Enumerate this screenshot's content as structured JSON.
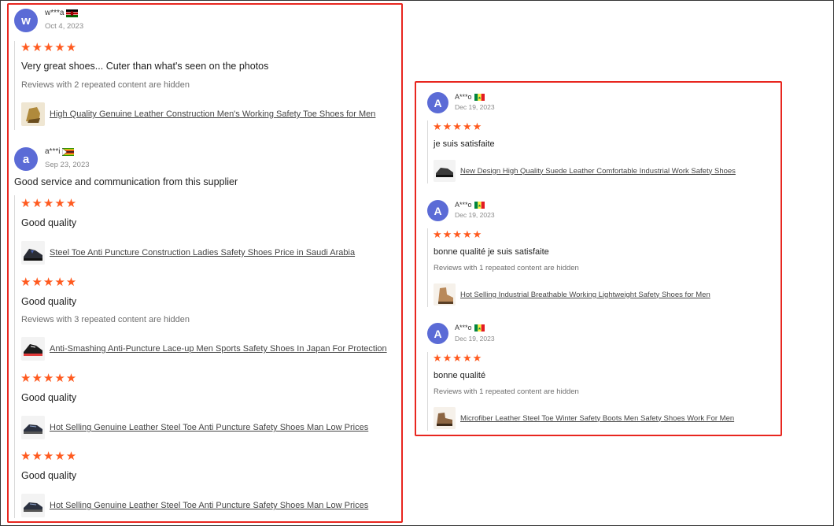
{
  "colors": {
    "highlight_border": "#e8261f",
    "star": "#ff5a1f",
    "avatar": "#5b6bd6"
  },
  "left_panel": {
    "reviewers": [
      {
        "avatar": "w",
        "name": "w***a",
        "flag": "kenya-flag",
        "date": "Oct 4, 2023",
        "reviews": [
          {
            "stars": "★★★★★",
            "text": "Very great shoes... Cuter than what's seen on the photos",
            "hidden_note": "Reviews with 2 repeated content are hidden",
            "product": "High Quality Genuine Leather Construction Men's Working Safety Toe Shoes for Men"
          }
        ]
      },
      {
        "avatar": "a",
        "name": "a***i",
        "flag": "zimbabwe-flag",
        "date": "Sep 23, 2023",
        "comment": "Good service and communication from this supplier",
        "reviews": [
          {
            "stars": "★★★★★",
            "text": "Good quality",
            "product": "Steel Toe Anti Puncture Construction Ladies Safety Shoes Price in Saudi Arabia"
          },
          {
            "stars": "★★★★★",
            "text": "Good quality",
            "hidden_note": "Reviews with 3 repeated content are hidden",
            "product": "Anti-Smashing Anti-Puncture Lace-up Men Sports Safety Shoes In Japan For Protection"
          },
          {
            "stars": "★★★★★",
            "text": "Good quality",
            "product": "Hot Selling Genuine Leather Steel Toe Anti Puncture Safety Shoes Man Low Prices"
          },
          {
            "stars": "★★★★★",
            "text": "Good quality",
            "product": "Hot Selling Genuine Leather Steel Toe Anti Puncture Safety Shoes Man Low Prices"
          }
        ]
      }
    ]
  },
  "right_panel": {
    "reviewers": [
      {
        "avatar": "A",
        "name": "A***o",
        "flag": "senegal-flag",
        "date": "Dec 19, 2023",
        "reviews": [
          {
            "stars": "★★★★★",
            "text": "je suis satisfaite",
            "product": "New Design High Quality Suede Leather Comfortable Industrial Work Safety Shoes"
          }
        ]
      },
      {
        "avatar": "A",
        "name": "A***o",
        "flag": "senegal-flag",
        "date": "Dec 19, 2023",
        "reviews": [
          {
            "stars": "★★★★★",
            "text": "bonne qualité je suis satisfaite",
            "hidden_note": "Reviews with 1 repeated content are hidden",
            "product": "Hot Selling Industrial Breathable Working Lightweight Safety Shoes for Men"
          }
        ]
      },
      {
        "avatar": "A",
        "name": "A***o",
        "flag": "senegal-flag",
        "date": "Dec 19, 2023",
        "reviews": [
          {
            "stars": "★★★★★",
            "text": "bonne qualité",
            "hidden_note": "Reviews with 1 repeated content are hidden",
            "product": "Microfiber Leather Steel Toe Winter Safety Boots Men Safety Shoes Work For Men"
          }
        ]
      }
    ]
  }
}
